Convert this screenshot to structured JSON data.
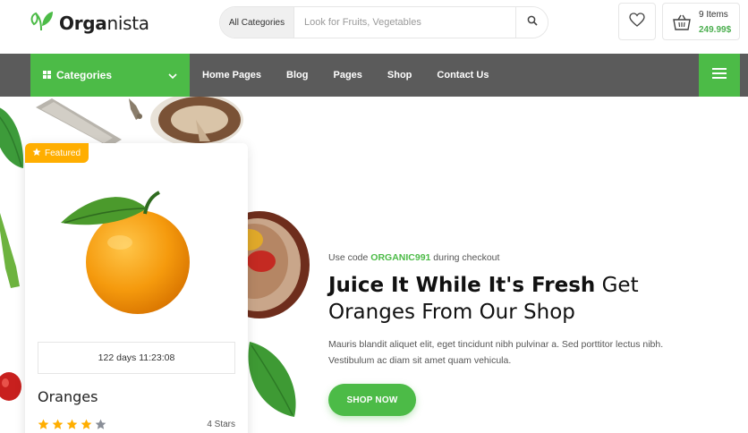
{
  "brand": {
    "name_bold": "Orga",
    "name_light": "nista"
  },
  "search": {
    "category": "All Categories",
    "placeholder": "Look for Fruits, Vegetables"
  },
  "cart": {
    "items": "9 Items",
    "total": "249.99$"
  },
  "nav": {
    "categories_label": "Categories",
    "links": [
      "Home Pages",
      "Blog",
      "Pages",
      "Shop",
      "Contact Us"
    ]
  },
  "product": {
    "badge": "Featured",
    "timer": "122 days 11:23:08",
    "name": "Oranges",
    "rating": 4,
    "rating_max": 5,
    "rating_label": "4 Stars"
  },
  "hero": {
    "promo_prefix": "Use code ",
    "promo_code": "ORGANIC991",
    "promo_suffix": " during checkout",
    "headline_strong": "Juice It While It's Fresh",
    "headline_rest": " Get Oranges From Our Shop",
    "description": "Mauris blandit aliquet elit, eget tincidunt nibh pulvinar a. Sed porttitor lectus nibh. Vestibulum ac diam sit amet quam vehicula.",
    "cta": "SHOP NOW"
  },
  "colors": {
    "accent": "#4cbb47",
    "nav_bg": "#5b5b5b",
    "badge": "#ffae00",
    "star": "#ffae00"
  }
}
